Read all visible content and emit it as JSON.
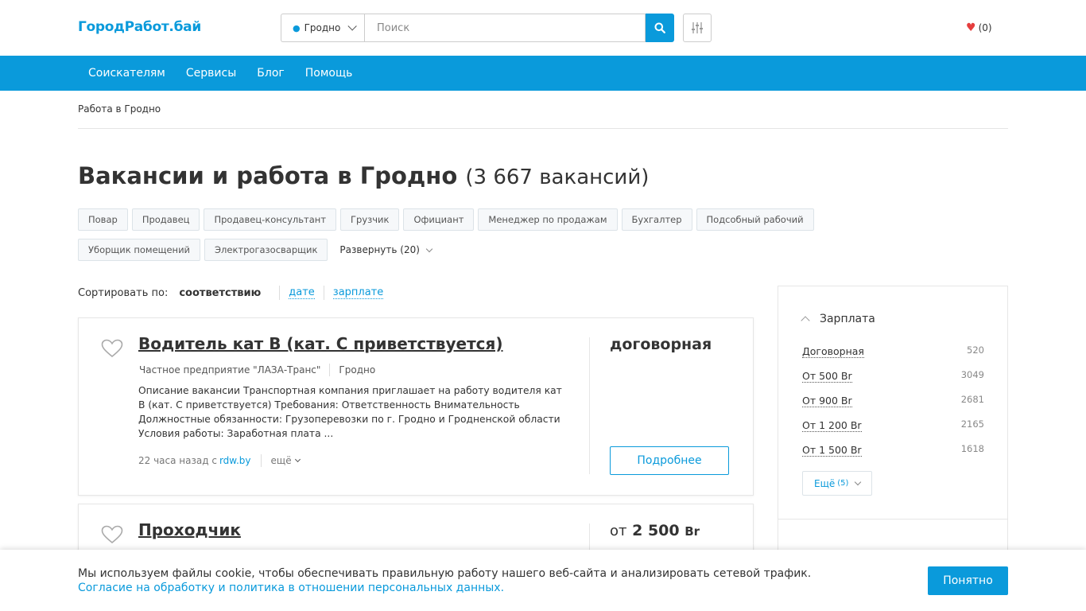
{
  "header": {
    "logo": "ГородРабот.бай",
    "city": "Гродно",
    "search_placeholder": "Поиск",
    "favorites": "(0)"
  },
  "nav": [
    "Соискателям",
    "Сервисы",
    "Блог",
    "Помощь"
  ],
  "breadcrumb": "Работа в Гродно",
  "page": {
    "title": "Вакансии и работа в Гродно",
    "count": "(3 667 вакансий)"
  },
  "tags": [
    "Повар",
    "Продавец",
    "Продавец-консультант",
    "Грузчик",
    "Официант",
    "Менеджер по продажам",
    "Бухгалтер",
    "Подсобный рабочий",
    "Уборщик помещений",
    "Электрогазосварщик"
  ],
  "expand_label": "Развернуть (20)",
  "sort": {
    "label": "Сортировать по:",
    "active": "соответствию",
    "date": "дате",
    "salary": "зарплате"
  },
  "vacancies": [
    {
      "title": "Водитель кат B (кат. C приветствуется)",
      "company": "Частное предприятие \"ЛАЗА-Транс\"",
      "city": "Гродно",
      "description": "Описание вакансии Транспортная компания приглашает на работу водителя кат B (кат. C приветствуется) Требования: Ответственность Внимательность Должностные обязанности: Грузоперевозки по г. Гродно и Гродненской области Условия работы: Заработная плата ...",
      "posted": "22 часа назад с",
      "source": "rdw.by",
      "more": "ещё",
      "salary": "договорная",
      "details": "Подробнее"
    },
    {
      "title": "Проходчик",
      "salary_from": "от",
      "salary_value": "2 500",
      "salary_currency": "Br"
    }
  ],
  "sidebar": {
    "salary_title": "Зарплата",
    "salary_items": [
      {
        "label": "Договорная",
        "count": "520"
      },
      {
        "label": "От 500 Br",
        "count": "3049"
      },
      {
        "label": "От 900 Br",
        "count": "2681"
      },
      {
        "label": "От 1 200 Br",
        "count": "2165"
      },
      {
        "label": "От 1 500 Br",
        "count": "1618"
      }
    ],
    "more_label": "Ещё",
    "more_count": "(5)"
  },
  "cookie": {
    "text": "Мы используем файлы cookie, чтобы обеспечивать правильную работу нашего веб-сайта и анализировать сетевой трафик.",
    "link": "Согласие на обработку и политика в отношении персональных данных.",
    "button": "Понятно"
  },
  "colors": {
    "accent": "#0a9adb",
    "heart": "#e53e3e"
  }
}
